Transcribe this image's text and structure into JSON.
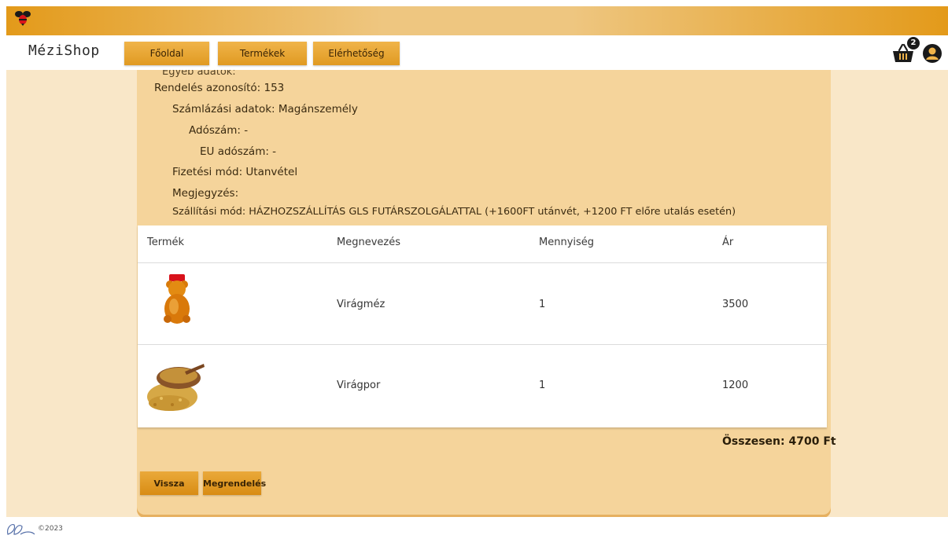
{
  "brand": "MéziShop",
  "nav": {
    "home": "Főoldal",
    "products": "Termékek",
    "contact": "Elérhetőség"
  },
  "cart": {
    "count": "2"
  },
  "order": {
    "cut_text": "Egyéb adatok:",
    "id_line": "Rendelés azonosító: 153",
    "billing_line": "Számlázási adatok: Magánszemély",
    "tax_line": "Adószám: -",
    "eu_tax_line": "EU adószám: -",
    "payment_line": "Fizetési mód: Utanvétel",
    "note_line": "Megjegyzés:",
    "shipping_line": "Szállítási mód: HÁZHOZSZÁLLÍTÁS GLS FUTÁRSZOLGÁLATTAL (+1600FT utánvét, +1200 FT előre utalás esetén)"
  },
  "table": {
    "headers": [
      "Termék",
      "Megnevezés",
      "Mennyiség",
      "Ár"
    ],
    "rows": [
      {
        "image": "honey-bear-jar-image",
        "name": "Virágméz",
        "qty": "1",
        "price": "3500"
      },
      {
        "image": "pollen-bowl-image",
        "name": "Virágpor",
        "qty": "1",
        "price": "1200"
      }
    ]
  },
  "total": "Összesen: 4700 Ft",
  "buttons": {
    "back": "Vissza",
    "order": "Megrendelés"
  },
  "footer": {
    "copyright": "©2023"
  },
  "colors": {
    "accent": "#e39a1a",
    "card": "#f5d49b",
    "background": "#f9e7c8"
  }
}
